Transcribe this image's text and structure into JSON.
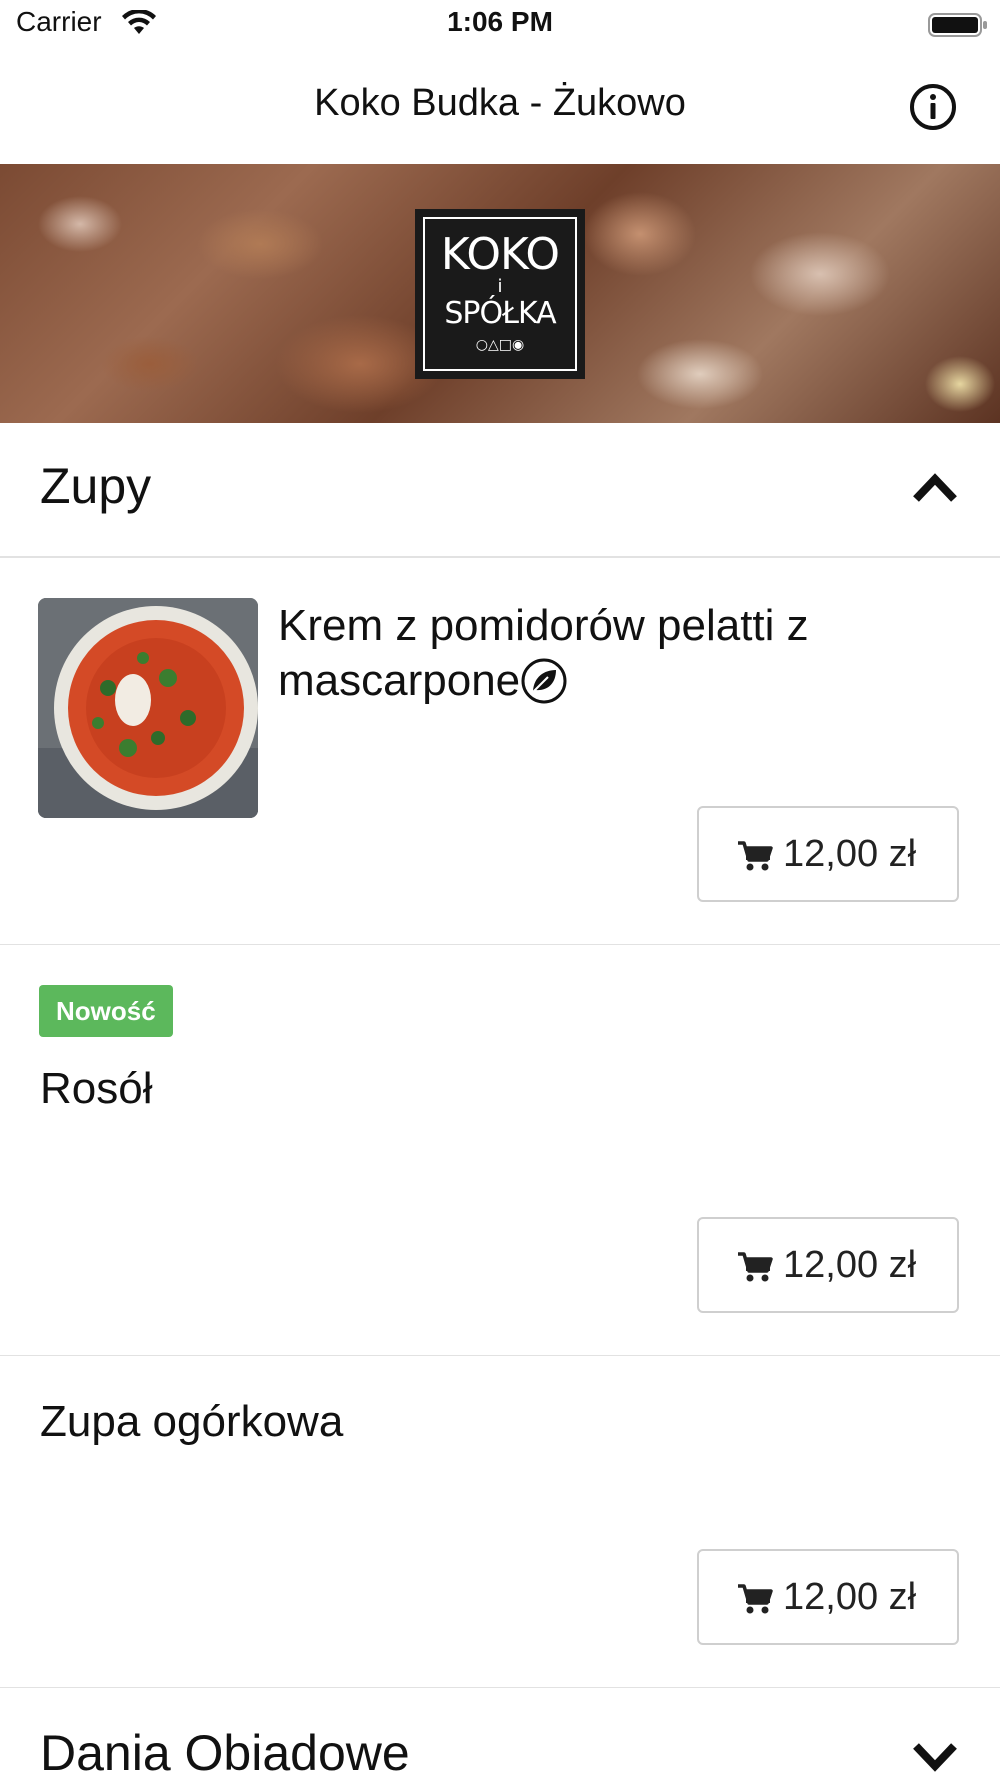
{
  "status_bar": {
    "carrier": "Carrier",
    "time": "1:06 PM"
  },
  "nav": {
    "title": "Koko Budka - Żukowo",
    "info_icon": "info-icon"
  },
  "hero": {
    "logo_line1": "KOKO",
    "logo_line2": "i",
    "logo_line3": "SPÓŁKA"
  },
  "sections": [
    {
      "title": "Zupy",
      "expanded": true,
      "items": [
        {
          "name": "Krem z pomidorów pelatti z mascarpone",
          "vegetarian_icon": "leaf-icon",
          "price": "12,00 zł"
        },
        {
          "badge": "Nowość",
          "name": "Rosół",
          "price": "12,00 zł"
        },
        {
          "name": "Zupa ogórkowa",
          "price": "12,00 zł"
        }
      ]
    },
    {
      "title": "Dania Obiadowe",
      "expanded": false
    }
  ],
  "colors": {
    "badge_green": "#5cb85c",
    "divider": "#e2e2e2",
    "button_border": "#cfcfcf"
  }
}
